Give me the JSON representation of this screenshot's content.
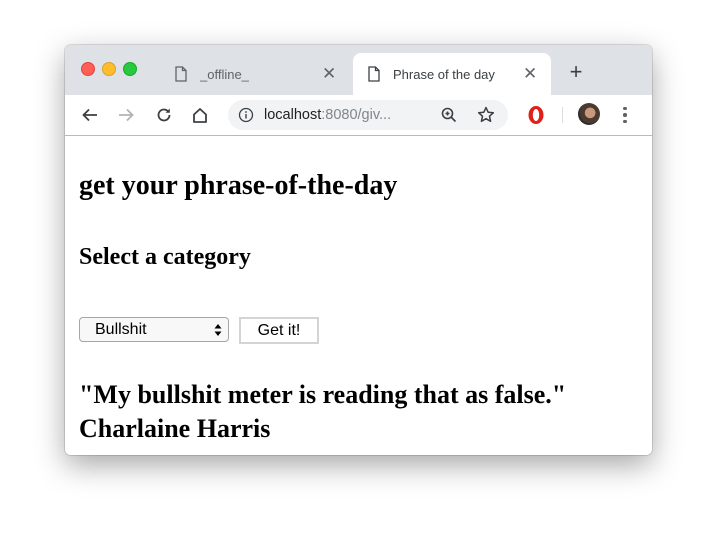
{
  "browser": {
    "tabs": [
      {
        "title": "_offline_",
        "active": false,
        "icon": "document-icon"
      },
      {
        "title": "Phrase of the day",
        "active": true,
        "icon": "document-icon"
      }
    ],
    "new_tab_label": "+",
    "close_glyph": "✕",
    "address": {
      "host": "localhost",
      "rest": ":8080/giv..."
    },
    "toolbar_icons": [
      "back-icon",
      "forward-icon",
      "reload-icon",
      "home-icon",
      "info-icon",
      "zoom-icon",
      "bookmark-star-icon",
      "opera-extension-icon",
      "profile-avatar",
      "menu-icon"
    ]
  },
  "page": {
    "title": "get your phrase-of-the-day",
    "subtitle": "Select a category",
    "category_select": {
      "selected": "Bullshit"
    },
    "submit_label": "Get it!",
    "quote": "\"My bullshit meter is reading that as false.\"",
    "author": "Charlaine Harris"
  }
}
